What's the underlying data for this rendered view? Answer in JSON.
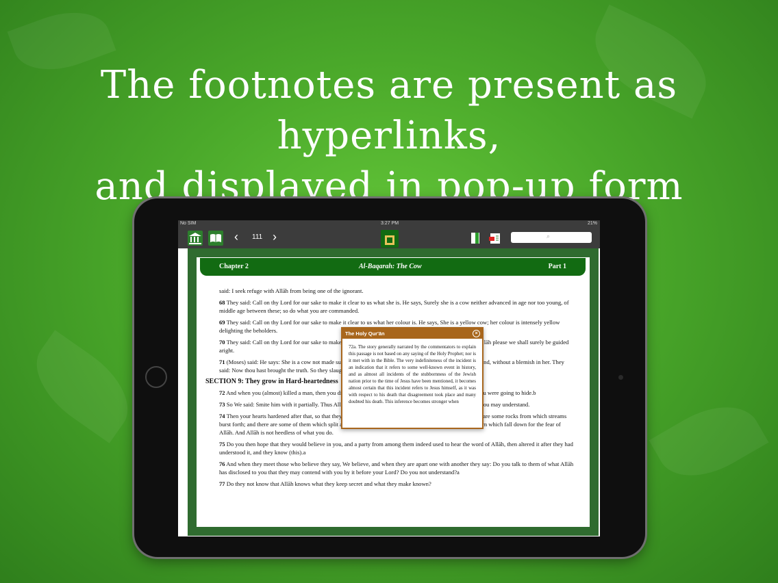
{
  "headline": {
    "line1": "The footnotes are present as hyperlinks,",
    "line2": "and displayed in pop-up form"
  },
  "statusbar": {
    "carrier": "No SIM",
    "time": "3:27 PM",
    "battery": "21%"
  },
  "toolbar": {
    "page_number": "111",
    "prev": "‹",
    "next": "›",
    "search_glyph": "⌕"
  },
  "chapter": {
    "left": "Chapter 2",
    "center": "Al-Baqarah: The Cow",
    "right": "Part 1"
  },
  "verses": [
    {
      "num": "",
      "text": "said: I seek refuge with Allāh from being one of the ignorant."
    },
    {
      "num": "68",
      "text": " They said: Call on thy Lord for our sake to make it clear to us what she is. He says, Surely she is a cow neither advanced in age nor too young, of middle age between these; so do what you are commanded."
    },
    {
      "num": "69",
      "text": " They said: Call on thy Lord for our sake to make it clear to us what her colour is. He says, She is a yellow cow; her colour is intensely yellow delighting the beholders."
    },
    {
      "num": "70",
      "text": " They said: Call on thy Lord for our sake to make it clear to us what she is, for the cows are all alike, and if Allāh please we shall surely be guided aright."
    },
    {
      "num": "71",
      "text": " (Moses) said: He says: She is a cow not made submissive to plough the land, nor does she water the tilth, sound, without a blemish in her. They said: Now thou hast brought the truth. So they slaughtered her, though they had not the mind to do (it).a"
    }
  ],
  "section_title": "SECTION 9: They grow in Hard-heartedness",
  "verses2": [
    {
      "num": "72",
      "text": " And when you (almost) killed a man, then you disagreed about it. And Allāh was to bring forth that which you were going to hide.b"
    },
    {
      "num": "73",
      "text": " So We said: Smite him with it partially. Thus Allāh brings the dead to life, and He shows you His signs that you may understand."
    },
    {
      "num": "74",
      "text": " Then your hearts hardened after that, so that they were like rocks, rather worse in hardness. And surely there are some rocks from which streams burst forth; and there are some of them which split asunder so water flows from them; and there are some of them which fall down for the fear of Allāh. And Allāh is not heedless of what you do."
    },
    {
      "num": "75",
      "text": " Do you then hope that they would believe in you, and a party from among them indeed used to hear the word of Allāh, then altered it after they had understood it, and they know (this).a"
    },
    {
      "num": "76",
      "text": " And when they meet those who believe they say, We believe, and when they are apart one with another they say: Do you talk to them of what Allāh has disclosed to you that they may contend with you by it before your Lord? Do you not understand?a"
    },
    {
      "num": "77",
      "text": " Do they not know that Allāh knows what they keep secret and what they make known?"
    }
  ],
  "popup": {
    "title": "The Holy Qur'ān",
    "close": "×",
    "text": "72a. The story generally narrated by the commentators to explain this passage is not based on any saying of the Holy Prophet; nor is it met with in the Bible. The very indefiniteness of the incident is an indication that it refers to some well-known event in history, and as almost all incidents of the stubbornness of the Jewish nation prior to the time of Jesus have been mentioned, it becomes almost certain that this incident refers to Jesus himself, as it was with respect to his death that disagreement took place and many doubted his death. This inference becomes stronger when"
  },
  "colors": {
    "accent_green": "#126b12",
    "popup_border": "#a8661c",
    "toolbar": "#3c3c3c"
  }
}
